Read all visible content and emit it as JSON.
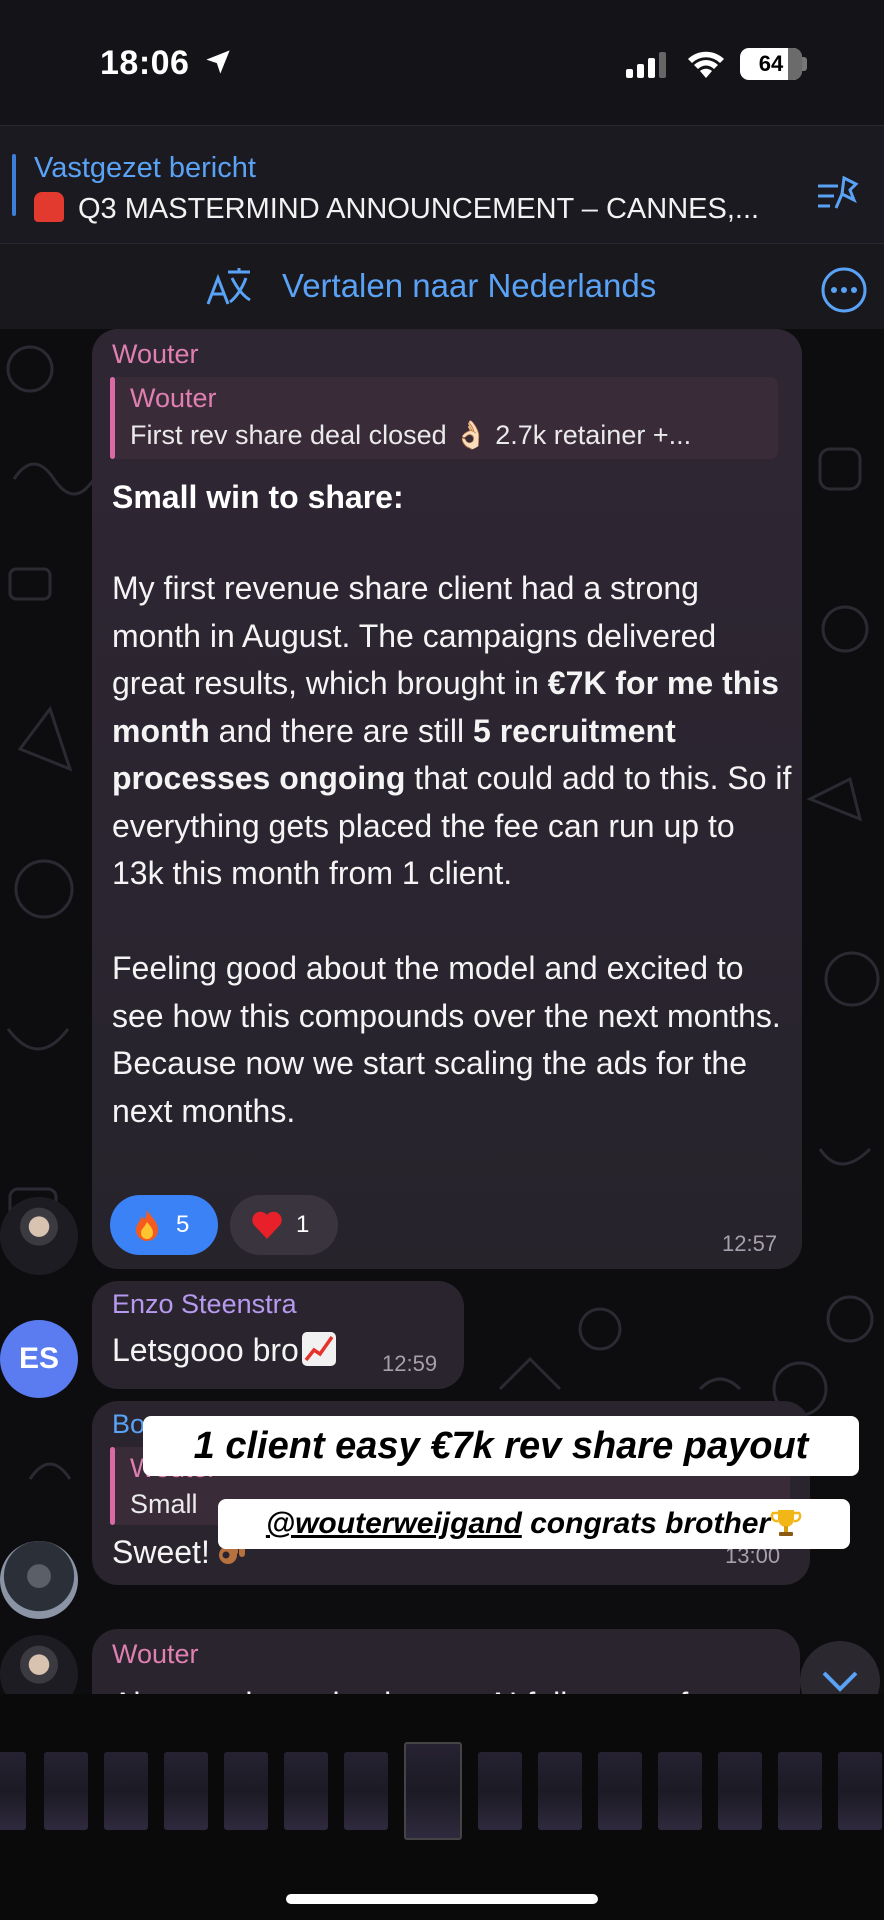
{
  "status_bar": {
    "time": "18:06",
    "battery": "64"
  },
  "pinned": {
    "title": "Vastgezet bericht",
    "text": "Q3 MASTERMIND ANNOUNCEMENT – CANNES,..."
  },
  "translate": {
    "label": "Vertalen naar Nederlands"
  },
  "messages": [
    {
      "sender": "Wouter",
      "reply_name": "Wouter",
      "reply_text": "First rev share deal closed 👌🏻 2.7k retainer +...",
      "title": "Small win to share:",
      "body_parts": [
        "My first revenue share client had a strong month in August. The campaigns delivered great results, which brought in ",
        "€7K for me this month",
        " and there are still ",
        "5 recruitment processes ongoing",
        " that could add to this. So if everything gets placed the fee can run up to 13k this month from 1 client.\n\nFeeling good about the model and excited to see how this compounds over the next months. Because now we start scaling the ads for the next months."
      ],
      "reactions": [
        {
          "emoji": "fire-icon",
          "count": "5"
        },
        {
          "emoji": "heart-icon",
          "count": "1"
        }
      ],
      "time": "12:57"
    },
    {
      "sender": "Enzo Steenstra",
      "avatar_initials": "ES",
      "text": "Letsgooo bro",
      "time": "12:59"
    },
    {
      "sender": "Bo",
      "reply_name": "Wouter",
      "reply_text": "Small",
      "text": "Sweet!",
      "time": "13:00"
    },
    {
      "sender": "Wouter",
      "text": "Also starting to implement AI follow-ups for"
    }
  ],
  "overlays": {
    "caption": "1 client easy €7k rev share payout",
    "mention": "@wouterweijgand",
    "mention_suffix": " congrats brother"
  },
  "colors": {
    "accent": "#5aa2f5",
    "sender_pink": "#e07fb1",
    "reaction_active": "#3b82f6"
  }
}
